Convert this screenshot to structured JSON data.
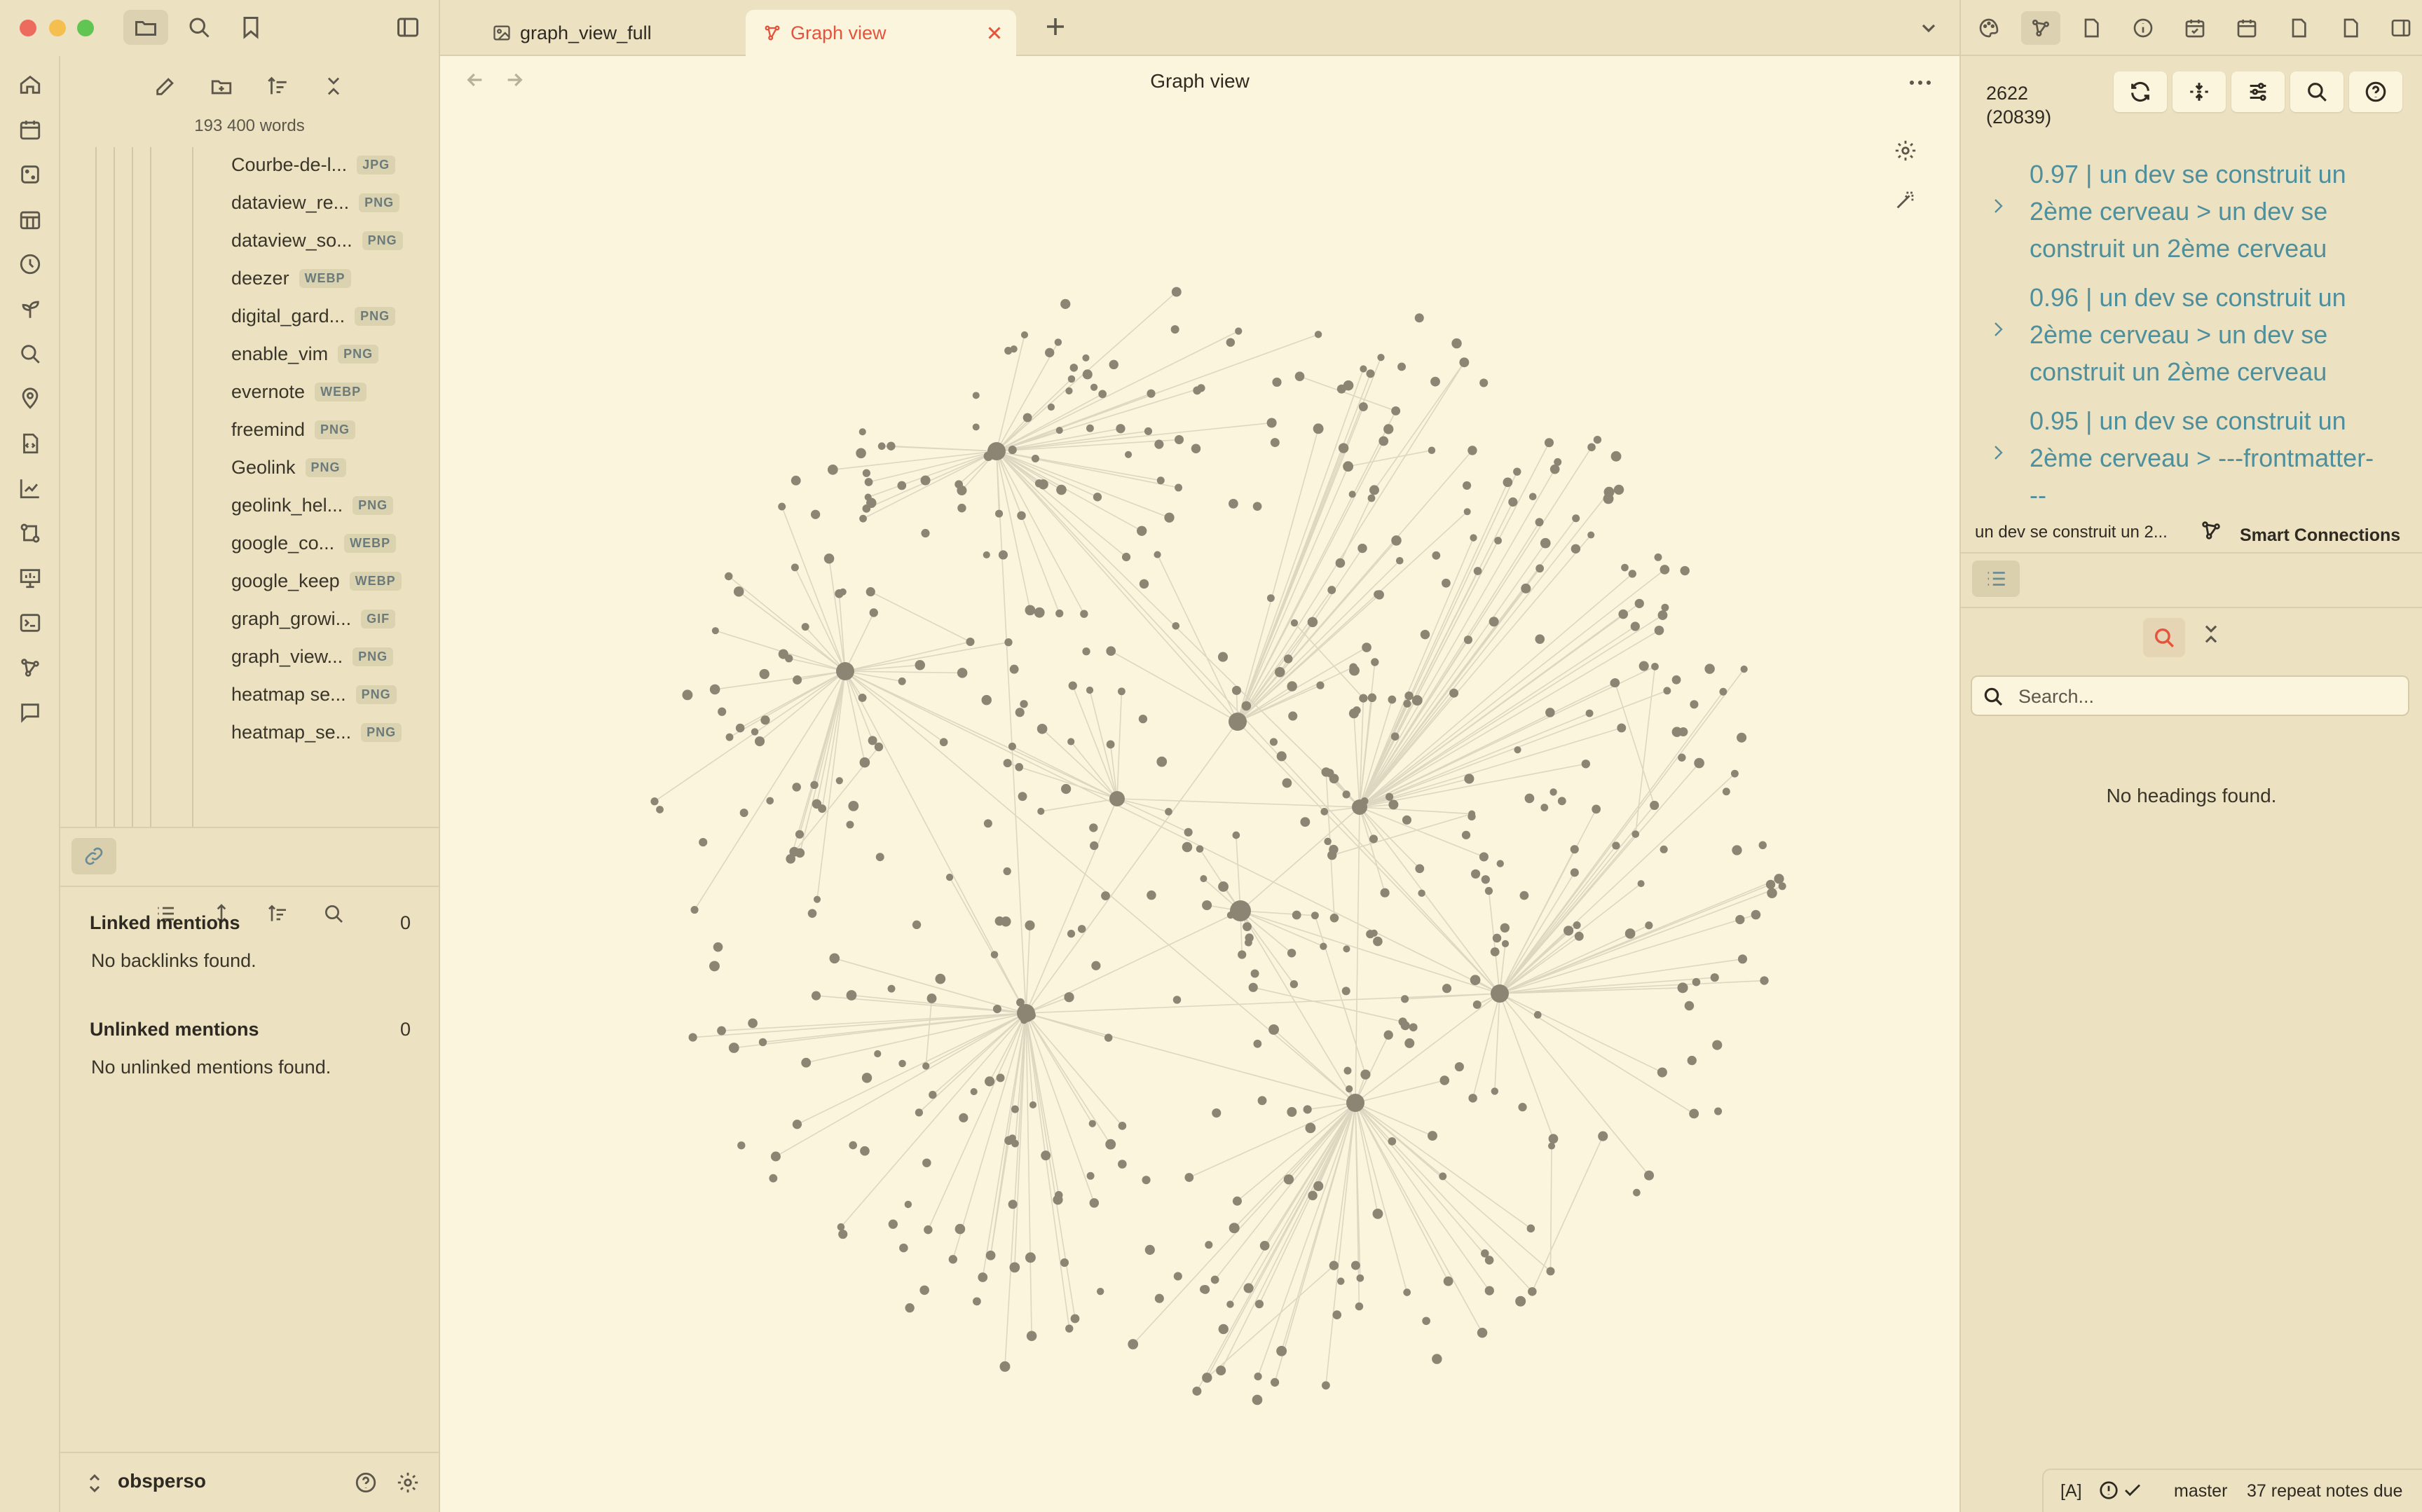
{
  "left_panel": {
    "word_count": "193 400 words",
    "files": [
      {
        "name": "Courbe-de-l...",
        "ext": "JPG"
      },
      {
        "name": "dataview_re...",
        "ext": "PNG"
      },
      {
        "name": "dataview_so...",
        "ext": "PNG"
      },
      {
        "name": "deezer",
        "ext": "WEBP"
      },
      {
        "name": "digital_gard...",
        "ext": "PNG"
      },
      {
        "name": "enable_vim",
        "ext": "PNG"
      },
      {
        "name": "evernote",
        "ext": "WEBP"
      },
      {
        "name": "freemind",
        "ext": "PNG"
      },
      {
        "name": "Geolink",
        "ext": "PNG"
      },
      {
        "name": "geolink_hel...",
        "ext": "PNG"
      },
      {
        "name": "google_co...",
        "ext": "WEBP"
      },
      {
        "name": "google_keep",
        "ext": "WEBP"
      },
      {
        "name": "graph_growi...",
        "ext": "GIF"
      },
      {
        "name": "graph_view...",
        "ext": "PNG"
      },
      {
        "name": "heatmap se...",
        "ext": "PNG"
      },
      {
        "name": "heatmap_se...",
        "ext": "PNG"
      }
    ],
    "backlinks": {
      "linked_title": "Linked mentions",
      "linked_count": "0",
      "linked_empty": "No backlinks found.",
      "unlinked_title": "Unlinked mentions",
      "unlinked_count": "0",
      "unlinked_empty": "No unlinked mentions found."
    },
    "vault_name": "obsperso"
  },
  "tabs": [
    {
      "label": "graph_view_full",
      "icon": "image-icon",
      "active": false
    },
    {
      "label": "Graph view",
      "icon": "graph-icon",
      "active": true
    }
  ],
  "view": {
    "title": "Graph view"
  },
  "smart_connections": {
    "count": "2622",
    "count_total": "(20839)",
    "results": [
      {
        "text": "0.97 | un dev se construit un 2ème cerveau > un dev se construit un 2ème cerveau"
      },
      {
        "text": "0.96 | un dev se construit un 2ème cerveau > un dev se construit un 2ème cerveau"
      },
      {
        "text": "0.95 | un dev se construit un 2ème cerveau > ---frontmatter---"
      }
    ],
    "current_note": "un dev se construit un 2...",
    "brand": "Smart Connections"
  },
  "outline": {
    "search_placeholder": "Search...",
    "empty": "No headings found."
  },
  "status_bar": {
    "mode": "[A]",
    "branch": "master",
    "repeat": "37 repeat notes due"
  },
  "colors": {
    "background": "#fbf5dd",
    "sidebar": "#ece2c2",
    "accent": "#e5533c",
    "link": "#4f8f9b",
    "node": "#8d8574",
    "edge": "#ddd6c0"
  },
  "graph": {
    "node_count": 540,
    "hub_count": 9
  }
}
